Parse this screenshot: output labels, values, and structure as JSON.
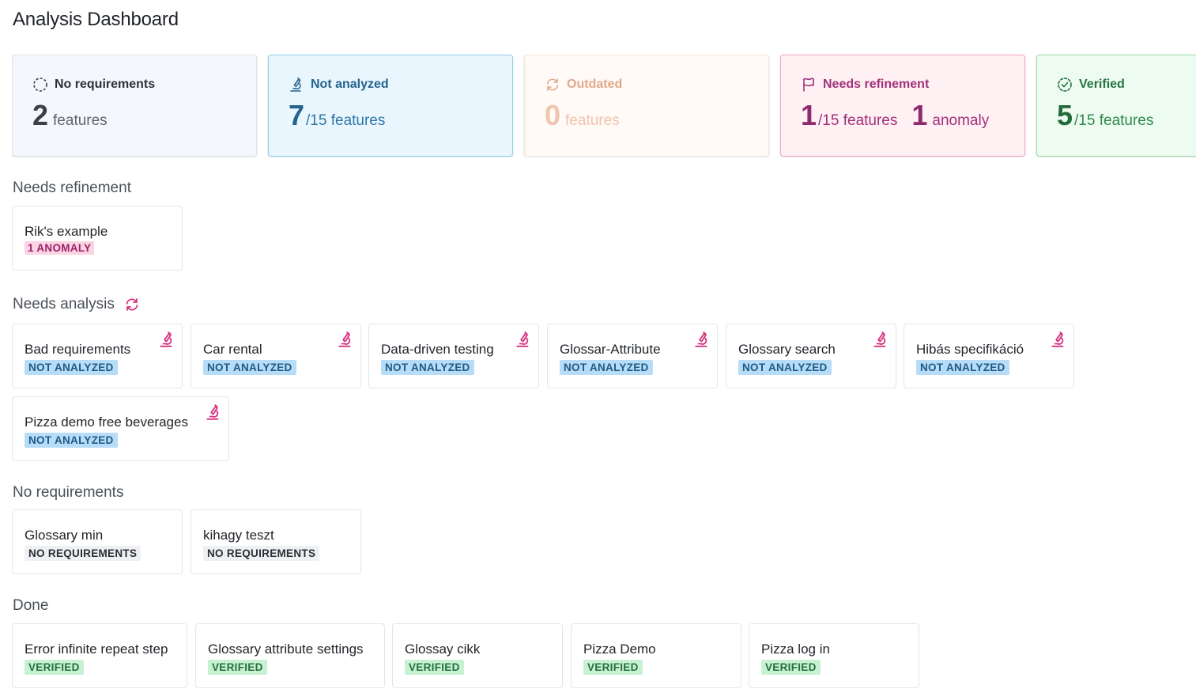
{
  "page_title": "Analysis Dashboard",
  "stats": {
    "no_requirements": {
      "label": "No requirements",
      "value": "2",
      "unit": "features",
      "icon": "dashed-circle-icon"
    },
    "not_analyzed": {
      "label": "Not analyzed",
      "value": "7",
      "unit": "/15 features",
      "icon": "microscope-icon"
    },
    "outdated": {
      "label": "Outdated",
      "value": "0",
      "unit": "features",
      "icon": "refresh-icon"
    },
    "needs_refinement": {
      "label": "Needs refinement",
      "value": "1",
      "unit": "/15 features",
      "value2": "1",
      "unit2": "anomaly",
      "icon": "flag-icon"
    },
    "verified": {
      "label": "Verified",
      "value": "5",
      "unit": "/15 features",
      "icon": "check-circle-icon"
    }
  },
  "sections": {
    "needs_refinement": {
      "title": "Needs refinement",
      "cards": [
        {
          "name": "Rik's example",
          "badge": "1 ANOMALY"
        }
      ]
    },
    "needs_analysis": {
      "title": "Needs analysis",
      "cards": [
        {
          "name": "Bad requirements",
          "badge": "NOT ANALYZED"
        },
        {
          "name": "Car rental",
          "badge": "NOT ANALYZED"
        },
        {
          "name": "Data-driven testing",
          "badge": "NOT ANALYZED"
        },
        {
          "name": "Glossar-Attribute",
          "badge": "NOT ANALYZED"
        },
        {
          "name": "Glossary search",
          "badge": "NOT ANALYZED"
        },
        {
          "name": "Hibás specifikáció",
          "badge": "NOT ANALYZED"
        },
        {
          "name": "Pizza demo free beverages",
          "badge": "NOT ANALYZED"
        }
      ]
    },
    "no_requirements": {
      "title": "No requirements",
      "cards": [
        {
          "name": "Glossary min",
          "badge": "NO REQUIREMENTS"
        },
        {
          "name": "kihagy teszt",
          "badge": "NO REQUIREMENTS"
        }
      ]
    },
    "done": {
      "title": "Done",
      "cards": [
        {
          "name": "Error infinite repeat step",
          "badge": "VERIFIED"
        },
        {
          "name": "Glossary attribute settings",
          "badge": "VERIFIED"
        },
        {
          "name": "Glossay cikk",
          "badge": "VERIFIED"
        },
        {
          "name": "Pizza Demo",
          "badge": "VERIFIED"
        },
        {
          "name": "Pizza log in",
          "badge": "VERIFIED"
        }
      ]
    }
  },
  "colors": {
    "accent_pink": "#d6337f",
    "not_analyzed_blue": "#24638c",
    "verified_green": "#25733f",
    "refinement_magenta": "#a0317a"
  }
}
